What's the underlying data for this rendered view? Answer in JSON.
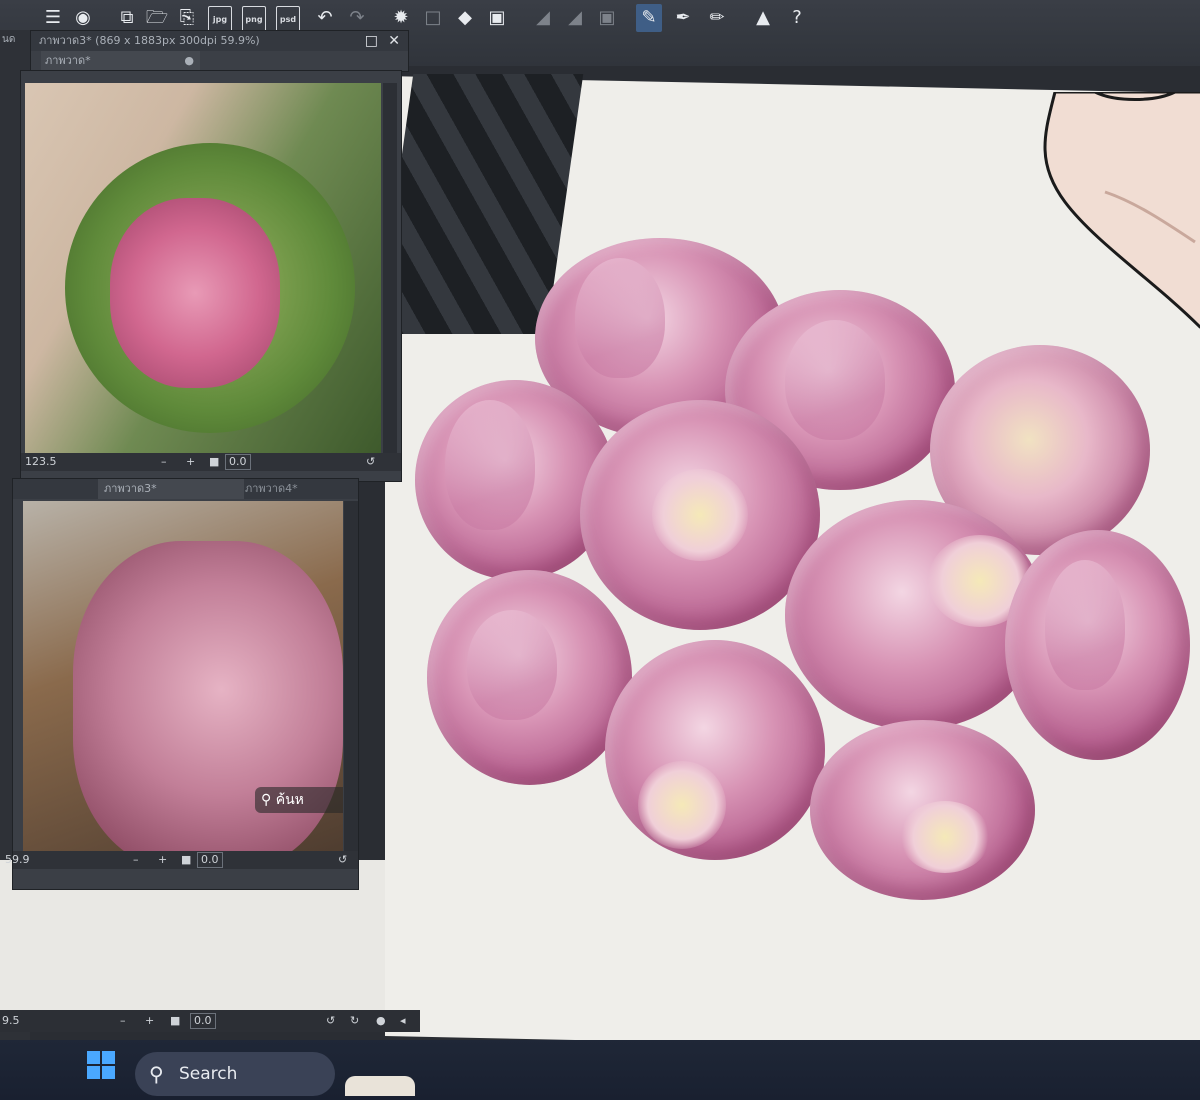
{
  "toolbar": {
    "file_buttons": [
      "jpg",
      "png",
      "psd"
    ]
  },
  "subview_top": {
    "title_info": "ภาพวาด3* (869 x 1883px 300dpi 59.9%)",
    "tab": "ภาพวาด*",
    "zoom": "123.5",
    "angle": "0.0"
  },
  "subview_bottom": {
    "tab_1": "ภาพวาด3*",
    "tab_2": "ภาพวาด4*",
    "search_chip": "ค้นห",
    "zoom": "59.9",
    "angle": "0.0"
  },
  "main_status": {
    "zoom": "9.5",
    "angle": "0.0"
  },
  "left_edge_label": "นด",
  "taskbar": {
    "search_placeholder": "Search"
  },
  "colors": {
    "accent": "#3f5e86",
    "lotus_pink": "#c4739c",
    "canvas": "#efeeea"
  },
  "icons": [
    "menu-icon",
    "app-logo-icon",
    "new-file-icon",
    "open-folder-icon",
    "save-icon",
    "undo-icon",
    "redo-icon",
    "loading-spinner-icon",
    "select-icon",
    "fill-icon",
    "transform-icon",
    "pen-icon",
    "brush-icon",
    "eraser-icon",
    "graduation-cap-icon",
    "help-icon",
    "close-icon",
    "maximize-icon",
    "windows-logo-icon",
    "search-icon"
  ]
}
